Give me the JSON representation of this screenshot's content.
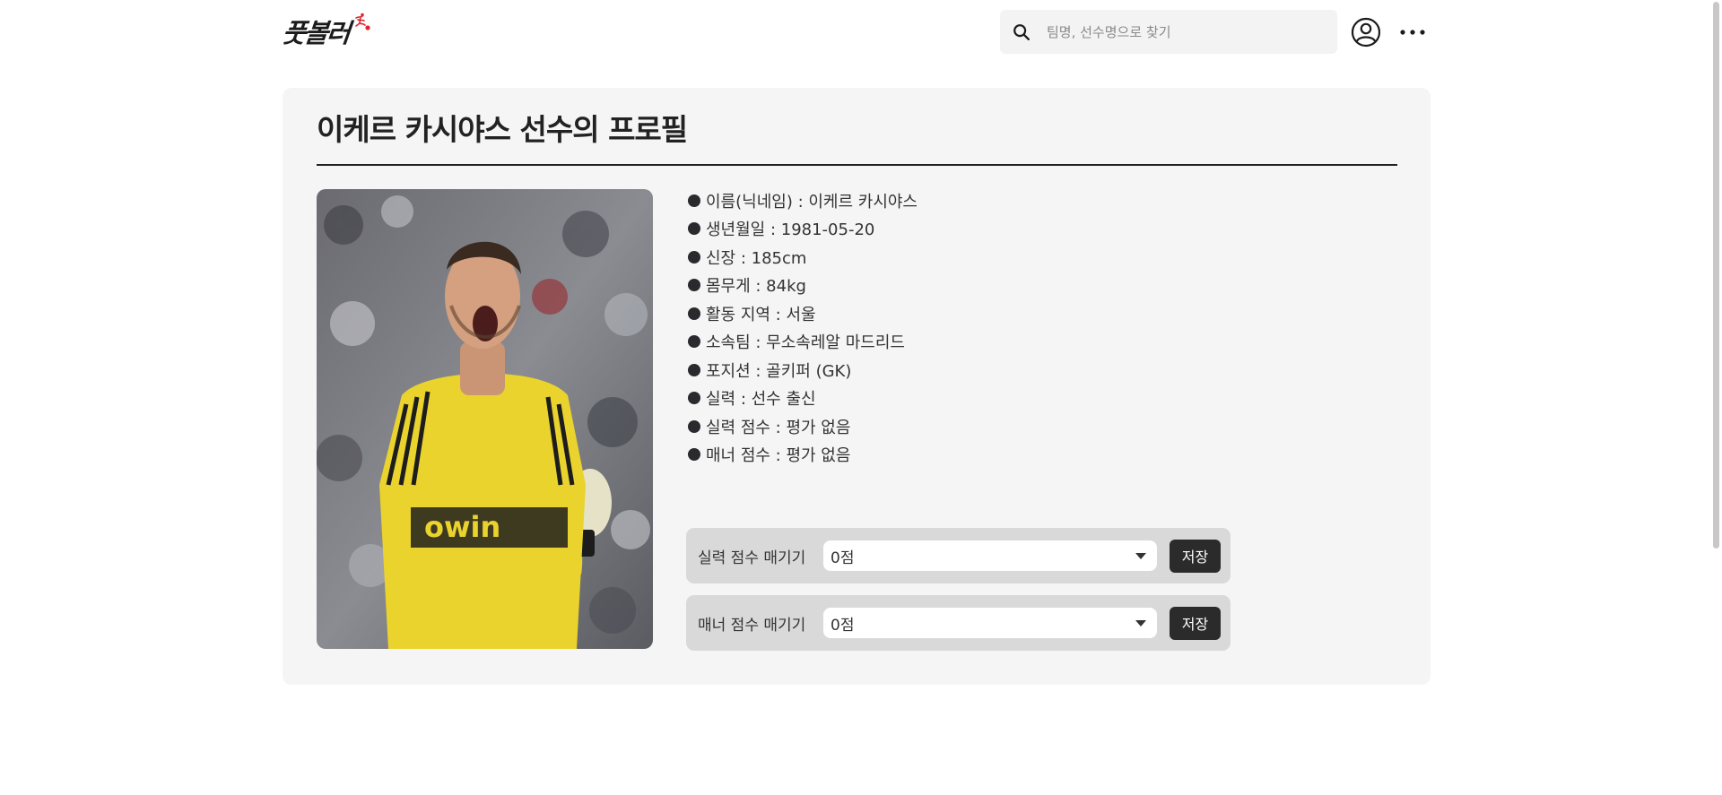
{
  "header": {
    "logo_text": "풋볼러",
    "search": {
      "placeholder": "팀명, 선수명으로 찾기",
      "value": ""
    },
    "icons": [
      "search-icon",
      "user-icon",
      "more-icon"
    ]
  },
  "profile": {
    "title": "이케르 카시야스 선수의 프로필",
    "photo_subject": "player-photo",
    "info": [
      "이름(닉네임) : 이케르 카시야스",
      "생년월일 : 1981-05-20",
      "신장 : 185cm",
      "몸무게 : 84kg",
      "활동 지역 : 서울",
      "소속팀 : 무소속레알 마드리드",
      "포지션 : 골키퍼 (GK)",
      "실력 : 선수 출신",
      "실력 점수 : 평가 없음",
      "매너 점수 : 평가 없음"
    ]
  },
  "rating": {
    "skill": {
      "label": "실력 점수 매기기",
      "selected": "0점",
      "save_label": "저장"
    },
    "manner": {
      "label": "매너 점수 매기기",
      "selected": "0점",
      "save_label": "저장"
    }
  },
  "colors": {
    "card_bg": "#f5f5f5",
    "rate_row_bg": "#d9d9d9",
    "button_bg": "#2b2b2b",
    "logo_accent": "#e0242a"
  }
}
